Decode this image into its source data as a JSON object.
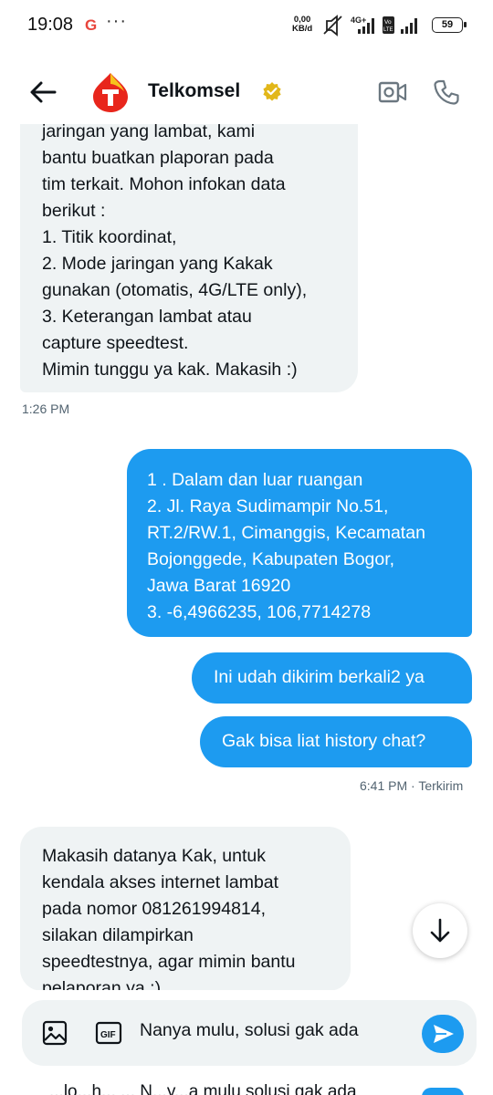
{
  "status_bar": {
    "time": "19:08",
    "google": "G",
    "more": "···",
    "speed_value": "0,00",
    "speed_unit": "KB/d",
    "network": "4G+",
    "volte": "Vo LTE",
    "battery": "59"
  },
  "header": {
    "title": "Telkomsel",
    "verified_icon": "verified-badge-icon",
    "brand_color": "#e8261c",
    "verified_color": "#e2b719"
  },
  "messages": {
    "m1": {
      "lines": [
        "jaringan yang lambat, kami",
        "bantu buatkan plaporan pada",
        "tim terkait. Mohon infokan data",
        "berikut :",
        "1. Titik koordinat,",
        "2. Mode jaringan yang Kakak",
        "gunakan (otomatis, 4G/LTE only),",
        "3. Keterangan lambat atau",
        "capture speedtest.",
        "Mimin tunggu ya kak. Makasih :)"
      ],
      "time": "1:26 PM"
    },
    "m2": {
      "lines": [
        "1 . Dalam dan luar ruangan",
        "2. Jl. Raya Sudimampir No.51,",
        "RT.2/RW.1, Cimanggis, Kecamatan",
        "Bojonggede, Kabupaten Bogor,",
        "Jawa Barat 16920",
        "3. -6,4966235, 106,7714278"
      ]
    },
    "m3": {
      "text": "Ini udah dikirim berkali2 ya"
    },
    "m4": {
      "text": "Gak bisa liat history chat?",
      "meta": "6:41 PM · Terkirim"
    },
    "m5": {
      "lines": [
        "Makasih datanya Kak, untuk",
        "kendala akses internet lambat",
        "pada nomor 081261994814,",
        "silakan dilampirkan",
        "speedtestnya, agar mimin bantu",
        "pelaporan ya :)"
      ]
    }
  },
  "composer": {
    "text": "Nanya mulu, solusi gak ada",
    "gif_label": "GIF"
  },
  "bottom_peek": {
    "text": "...lo...h... ... N...y...a mulu solusi gak ada"
  },
  "colors": {
    "accent": "#1d9bf0",
    "incoming_bg": "#eff3f4"
  }
}
